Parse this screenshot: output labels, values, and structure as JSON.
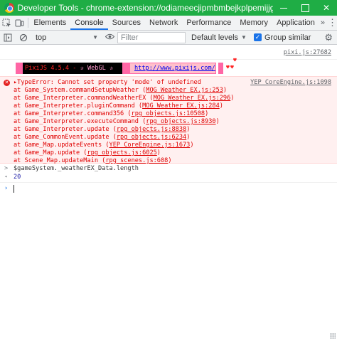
{
  "window": {
    "title": "Developer Tools - chrome-extension://odiameecjipmbmbejkplpemijjgpljce/...",
    "minimize": "",
    "maximize": "",
    "close": "✕"
  },
  "tabs": {
    "items": [
      "Elements",
      "Console",
      "Sources",
      "Network",
      "Performance",
      "Memory",
      "Application"
    ],
    "more": "»",
    "menu": "⋮"
  },
  "console_toolbar": {
    "context": "top",
    "filter_placeholder": "Filter",
    "levels": "Default levels",
    "group_similar": "Group similar"
  },
  "messages": {
    "pixi_source": "pixi.js:27682",
    "banner": {
      "text_a": "PixiJS 4.5.4 - ",
      "text_b": "✰ WebGL ✰",
      "url": "http://www.pixijs.com/",
      "heart": "♥"
    },
    "error": {
      "source": "YEP_CoreEngine.js:1098",
      "lines": [
        {
          "prefix": "▸TypeError: Cannot set property 'mode' of undefined",
          "link": "",
          "suffix": ""
        },
        {
          "prefix": "    at Game_System.commandSetupWeather (",
          "link": "MOG_Weather_EX.js:253",
          "suffix": ")"
        },
        {
          "prefix": "    at Game_Interpreter.commandWeatherEX (",
          "link": "MOG_Weather_EX.js:296",
          "suffix": ")"
        },
        {
          "prefix": "    at Game_Interpreter.pluginCommand (",
          "link": "MOG_Weather_EX.js:284",
          "suffix": ")"
        },
        {
          "prefix": "    at Game_Interpreter.command356 (",
          "link": "rpg_objects.js:10508",
          "suffix": ")"
        },
        {
          "prefix": "    at Game_Interpreter.executeCommand (",
          "link": "rpg_objects.js:8930",
          "suffix": ")"
        },
        {
          "prefix": "    at Game_Interpreter.update (",
          "link": "rpg_objects.js:8838",
          "suffix": ")"
        },
        {
          "prefix": "    at Game_CommonEvent.update (",
          "link": "rpg_objects.js:6234",
          "suffix": ")"
        },
        {
          "prefix": "    at Game_Map.updateEvents (",
          "link": "YEP_CoreEngine.js:1673",
          "suffix": ")"
        },
        {
          "prefix": "    at Game_Map.update (",
          "link": "rpg_objects.js:6025",
          "suffix": ")"
        },
        {
          "prefix": "    at Scene_Map.updateMain (",
          "link": "rpg_scenes.js:608",
          "suffix": ")"
        }
      ]
    },
    "command": "$gameSystem._weatherEX_Data.length",
    "result": "20",
    "input_chevron": ">",
    "output_chevron": "◂",
    "prompt_chevron": "›"
  },
  "icons": {
    "inspect": "inspect-element-icon",
    "device": "device-toolbar-icon",
    "clear": "clear-console-icon",
    "sidebar": "show-sidebar-icon",
    "eye": "live-expression-eye-icon",
    "settings": "settings-gear-icon",
    "error": "error-circle-icon"
  },
  "colors": {
    "titlebar": "#1fad45",
    "error_text": "#e00000",
    "error_bg": "#fff0f0",
    "active_tab": "#1a73e8",
    "banner_pink": "#ff66a5"
  }
}
